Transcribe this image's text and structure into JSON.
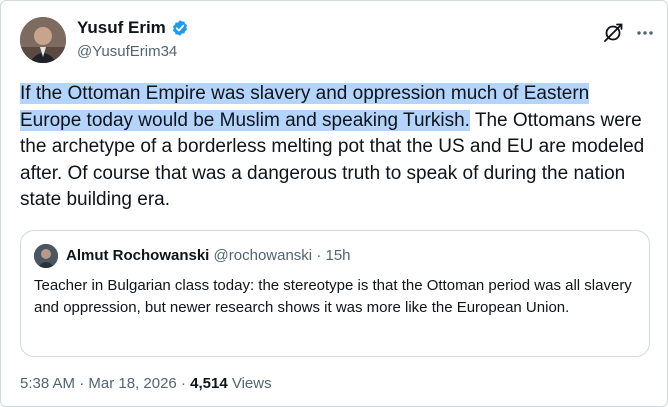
{
  "author": {
    "name": "Yusuf Erim",
    "handle": "@YusufErim34",
    "verified": true,
    "verified_color": "#1d9bf0"
  },
  "tweet": {
    "highlighted_text": "If the Ottoman Empire was slavery and oppression much of Eastern Europe today would be Muslim and speaking Turkish.",
    "rest_text": " The Ottomans were the archetype of a borderless melting pot that the US and EU are modeled after. Of course that was a dangerous truth to speak of during the nation state building era.",
    "highlight_color": "#b3d4fc"
  },
  "quoted": {
    "name": "Almut Rochowanski",
    "handle": "@rochowanski",
    "separator": "·",
    "time": "15h",
    "text": "Teacher in Bulgarian class today: the stereotype is that the Ottoman period was all slavery and oppression, but newer research shows it was more like the European Union."
  },
  "meta": {
    "time": "5:38 AM",
    "separator": "·",
    "date": "Mar 18, 2026",
    "views_count": "4,514",
    "views_label": "Views"
  },
  "icons": {
    "grok": "grok-icon",
    "more": "more-options-icon",
    "verified": "verified-badge-icon"
  }
}
